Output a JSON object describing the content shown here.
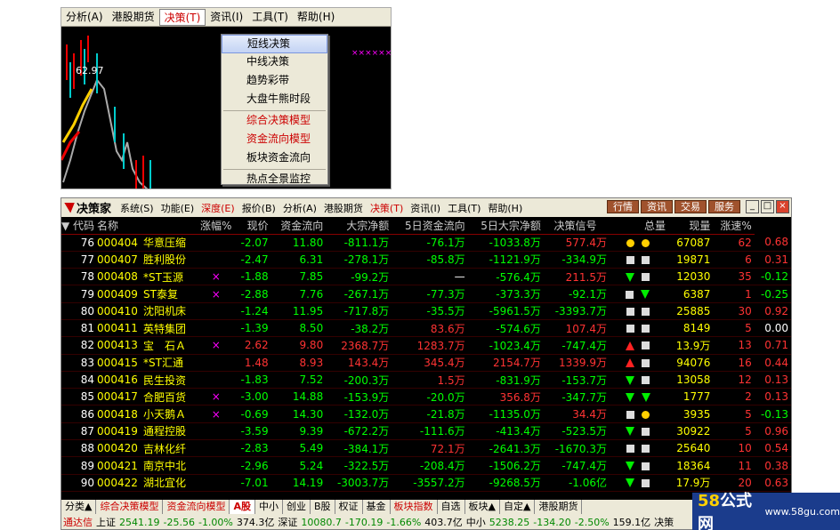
{
  "top_window": {
    "menu": [
      {
        "label": "分析(A)",
        "active": false
      },
      {
        "label": "港股期货",
        "active": false
      },
      {
        "label": "决策(T)",
        "active": true
      },
      {
        "label": "资讯(I)",
        "active": false
      },
      {
        "label": "工具(T)",
        "active": false
      },
      {
        "label": "帮助(H)",
        "active": false
      }
    ],
    "chart_price": "62.97",
    "dropdown": [
      {
        "label": "短线决策",
        "style": "hi"
      },
      {
        "label": "中线决策",
        "style": ""
      },
      {
        "label": "趋势彩带",
        "style": ""
      },
      {
        "label": "大盘牛熊时段",
        "style": ""
      },
      {
        "sep": true
      },
      {
        "label": "综合决策模型",
        "style": "red"
      },
      {
        "label": "资金流向模型",
        "style": "red"
      },
      {
        "label": "板块资金流向",
        "style": ""
      },
      {
        "sep": true
      },
      {
        "label": "热点全景监控",
        "style": ""
      }
    ]
  },
  "main_window": {
    "app_name": "决策家",
    "menu": [
      {
        "label": "系统(S)",
        "red": false
      },
      {
        "label": "功能(E)",
        "red": false
      },
      {
        "label": "深度(E)",
        "red": true
      },
      {
        "label": "报价(B)",
        "red": false
      },
      {
        "label": "分析(A)",
        "red": false
      },
      {
        "label": "港股期货",
        "red": false
      },
      {
        "label": "决策(T)",
        "red": true
      },
      {
        "label": "资讯(I)",
        "red": false
      },
      {
        "label": "工具(T)",
        "red": false
      },
      {
        "label": "帮助(H)",
        "red": false
      }
    ],
    "title_buttons": [
      "行情",
      "资讯",
      "交易",
      "服务"
    ],
    "columns": [
      "▼ 代码",
      "名称",
      "",
      "涨幅%",
      "现价",
      "资金流向",
      "大宗净额",
      "5日资金流向",
      "5日大宗净额",
      "决策信号",
      "总量",
      "现量",
      "涨速%"
    ],
    "rows": [
      {
        "idx": "76",
        "code": "000404",
        "name": "华意压缩",
        "mark": "",
        "pct": "-2.07",
        "price": "11.80",
        "flow": "-811.1万",
        "block": "-76.1万",
        "flow5": "-1033.8万",
        "block5": "577.4万",
        "sig": [
          "dot",
          "dot"
        ],
        "vol": "67087",
        "cur": "62",
        "speed": "0.68"
      },
      {
        "idx": "77",
        "code": "000407",
        "name": "胜利股份",
        "mark": "",
        "pct": "-2.47",
        "price": "6.31",
        "flow": "-278.1万",
        "block": "-85.8万",
        "flow5": "-1121.9万",
        "block5": "-334.9万",
        "sig": [
          "sq",
          "sq"
        ],
        "vol": "19871",
        "cur": "6",
        "speed": "0.31"
      },
      {
        "idx": "78",
        "code": "000408",
        "name": "*ST玉源",
        "mark": "×",
        "pct": "-1.88",
        "price": "7.85",
        "flow": "-99.2万",
        "block": "—",
        "flow5": "-576.4万",
        "block5": "211.5万",
        "sig": [
          "dn",
          "sq"
        ],
        "vol": "12030",
        "cur": "35",
        "speed": "-0.12"
      },
      {
        "idx": "79",
        "code": "000409",
        "name": "ST泰复",
        "mark": "×",
        "pct": "-2.88",
        "price": "7.76",
        "flow": "-267.1万",
        "block": "-77.3万",
        "flow5": "-373.3万",
        "block5": "-92.1万",
        "sig": [
          "sq",
          "dn"
        ],
        "vol": "6387",
        "cur": "1",
        "speed": "-0.25"
      },
      {
        "idx": "80",
        "code": "000410",
        "name": "沈阳机床",
        "mark": "",
        "pct": "-1.24",
        "price": "11.95",
        "flow": "-717.8万",
        "block": "-35.5万",
        "flow5": "-5961.5万",
        "block5": "-3393.7万",
        "sig": [
          "sq",
          "sq"
        ],
        "vol": "25885",
        "cur": "30",
        "speed": "0.92"
      },
      {
        "idx": "81",
        "code": "000411",
        "name": "英特集团",
        "mark": "",
        "pct": "-1.39",
        "price": "8.50",
        "flow": "-38.2万",
        "block": "83.6万",
        "flow5": "-574.6万",
        "block5": "107.4万",
        "sig": [
          "sq",
          "sq"
        ],
        "vol": "8149",
        "cur": "5",
        "speed": "0.00"
      },
      {
        "idx": "82",
        "code": "000413",
        "name": "宝　石Ａ",
        "mark": "×",
        "pct": "2.62",
        "price": "9.80",
        "flow": "2368.7万",
        "block": "1283.7万",
        "flow5": "-1023.4万",
        "block5": "-747.4万",
        "sig": [
          "up",
          "sq"
        ],
        "vol": "13.9万",
        "cur": "13",
        "speed": "0.71"
      },
      {
        "idx": "83",
        "code": "000415",
        "name": "*ST汇通",
        "mark": "",
        "pct": "1.48",
        "price": "8.93",
        "flow": "143.4万",
        "block": "345.4万",
        "flow5": "2154.7万",
        "block5": "1339.9万",
        "sig": [
          "up",
          "sq"
        ],
        "vol": "94076",
        "cur": "16",
        "speed": "0.44"
      },
      {
        "idx": "84",
        "code": "000416",
        "name": "民生投资",
        "mark": "",
        "pct": "-1.83",
        "price": "7.52",
        "flow": "-200.3万",
        "block": "1.5万",
        "flow5": "-831.9万",
        "block5": "-153.7万",
        "sig": [
          "dn",
          "sq"
        ],
        "vol": "13058",
        "cur": "12",
        "speed": "0.13"
      },
      {
        "idx": "85",
        "code": "000417",
        "name": "合肥百货",
        "mark": "×",
        "pct": "-3.00",
        "price": "14.88",
        "flow": "-153.9万",
        "block": "-20.0万",
        "flow5": "356.8万",
        "block5": "-347.7万",
        "sig": [
          "dn",
          "dn"
        ],
        "vol": "1777",
        "cur": "2",
        "speed": "0.13"
      },
      {
        "idx": "86",
        "code": "000418",
        "name": "小天鹅Ａ",
        "mark": "×",
        "pct": "-0.69",
        "price": "14.30",
        "flow": "-132.0万",
        "block": "-21.8万",
        "flow5": "-1135.0万",
        "block5": "34.4万",
        "sig": [
          "sq",
          "dot"
        ],
        "vol": "3935",
        "cur": "5",
        "speed": "-0.13"
      },
      {
        "idx": "87",
        "code": "000419",
        "name": "通程控股",
        "mark": "",
        "pct": "-3.59",
        "price": "9.39",
        "flow": "-672.2万",
        "block": "-111.6万",
        "flow5": "-413.4万",
        "block5": "-523.5万",
        "sig": [
          "dn",
          "sq"
        ],
        "vol": "30922",
        "cur": "5",
        "speed": "0.96"
      },
      {
        "idx": "88",
        "code": "000420",
        "name": "吉林化纤",
        "mark": "",
        "pct": "-2.83",
        "price": "5.49",
        "flow": "-384.1万",
        "block": "72.1万",
        "flow5": "-2641.3万",
        "block5": "-1670.3万",
        "sig": [
          "sq",
          "sq"
        ],
        "vol": "25640",
        "cur": "10",
        "speed": "0.54"
      },
      {
        "idx": "89",
        "code": "000421",
        "name": "南京中北",
        "mark": "",
        "pct": "-2.96",
        "price": "5.24",
        "flow": "-322.5万",
        "block": "-208.4万",
        "flow5": "-1506.2万",
        "block5": "-747.4万",
        "sig": [
          "dn",
          "sq"
        ],
        "vol": "18364",
        "cur": "11",
        "speed": "0.38"
      },
      {
        "idx": "90",
        "code": "000422",
        "name": "湖北宜化",
        "mark": "",
        "pct": "-7.01",
        "price": "14.19",
        "flow": "-3003.7万",
        "block": "-3557.2万",
        "flow5": "-9268.5万",
        "block5": "-1.06亿",
        "sig": [
          "dn",
          "sq"
        ],
        "vol": "17.9万",
        "cur": "20",
        "speed": "0.63"
      }
    ],
    "tabs": [
      {
        "label": "分类▲",
        "style": ""
      },
      {
        "label": "综合决策模型",
        "style": "red"
      },
      {
        "label": "资金流向模型",
        "style": "red"
      },
      {
        "label": "A股",
        "style": "sel"
      },
      {
        "label": "中小",
        "style": ""
      },
      {
        "label": "创业",
        "style": ""
      },
      {
        "label": "B股",
        "style": ""
      },
      {
        "label": "权证",
        "style": ""
      },
      {
        "label": "基金",
        "style": ""
      },
      {
        "label": "板块指数",
        "style": "red"
      },
      {
        "label": "自选",
        "style": ""
      },
      {
        "label": "板块▲",
        "style": ""
      },
      {
        "label": "自定▲",
        "style": ""
      },
      {
        "label": "港股期货",
        "style": ""
      }
    ],
    "status": [
      {
        "text": "通达信",
        "style": "red"
      },
      {
        "text": "上证",
        "style": ""
      },
      {
        "text": "2541.19",
        "style": "grn"
      },
      {
        "text": "-25.56",
        "style": "grn"
      },
      {
        "text": "-1.00%",
        "style": "grn"
      },
      {
        "text": "374.3亿",
        "style": ""
      },
      {
        "text": "深证",
        "style": ""
      },
      {
        "text": "10080.7",
        "style": "grn"
      },
      {
        "text": "-170.19",
        "style": "grn"
      },
      {
        "text": "-1.66%",
        "style": "grn"
      },
      {
        "text": "403.7亿",
        "style": ""
      },
      {
        "text": "中小",
        "style": ""
      },
      {
        "text": "5238.25",
        "style": "grn"
      },
      {
        "text": "-134.20",
        "style": "grn"
      },
      {
        "text": "-2.50%",
        "style": "grn"
      },
      {
        "text": "159.1亿",
        "style": ""
      },
      {
        "text": "决策",
        "style": ""
      }
    ]
  },
  "watermark": {
    "logo_a": "58",
    "logo_b": "公式网",
    "url": "www.58gu.com"
  }
}
